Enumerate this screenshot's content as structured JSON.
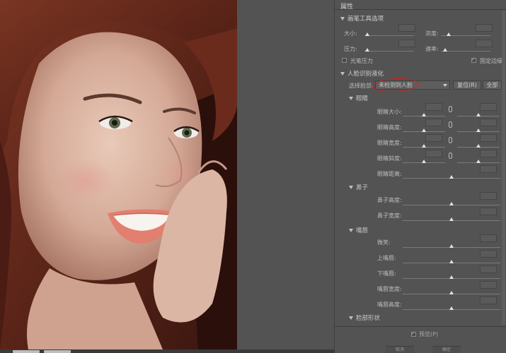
{
  "panel": {
    "title": "属性",
    "brush_section": {
      "title": "画笔工具选项",
      "size_label": "大小:",
      "size_value": "",
      "density_label": "浓度:",
      "density_value": "",
      "pressure_label": "压力:",
      "pressure_value": "",
      "rate_label": "速率:",
      "rate_value": "",
      "stylus_pressure_label": "光笔压力",
      "pin_edges_label": "固定边缘",
      "pin_edges_checked": true
    },
    "face_section": {
      "title": "人脸识别液化",
      "select_face_label": "选择脸部:",
      "select_face_value": "未检测到人脸",
      "reset_label": "复位(R)",
      "all_label": "全部",
      "eyes": {
        "title": "眼睛",
        "rows": [
          "眼睛大小:",
          "眼睛高度:",
          "眼睛宽度:",
          "眼睛斜度:",
          "眼睛距离:"
        ]
      },
      "nose": {
        "title": "鼻子",
        "rows": [
          "鼻子高度:",
          "鼻子宽度:"
        ]
      },
      "mouth": {
        "title": "嘴唇",
        "rows": [
          "微笑:",
          "上嘴唇:",
          "下嘴唇:",
          "嘴唇宽度:",
          "嘴唇高度:"
        ]
      },
      "face_shape": {
        "title": "脸部形状"
      }
    },
    "preview_label": "预览(P)",
    "preview_checked": true,
    "footer": {
      "cancel_label": "取消",
      "ok_label": "确定"
    }
  },
  "colors": {
    "panel_bg": "#535353",
    "highlight_ring": "#d91c1c"
  }
}
